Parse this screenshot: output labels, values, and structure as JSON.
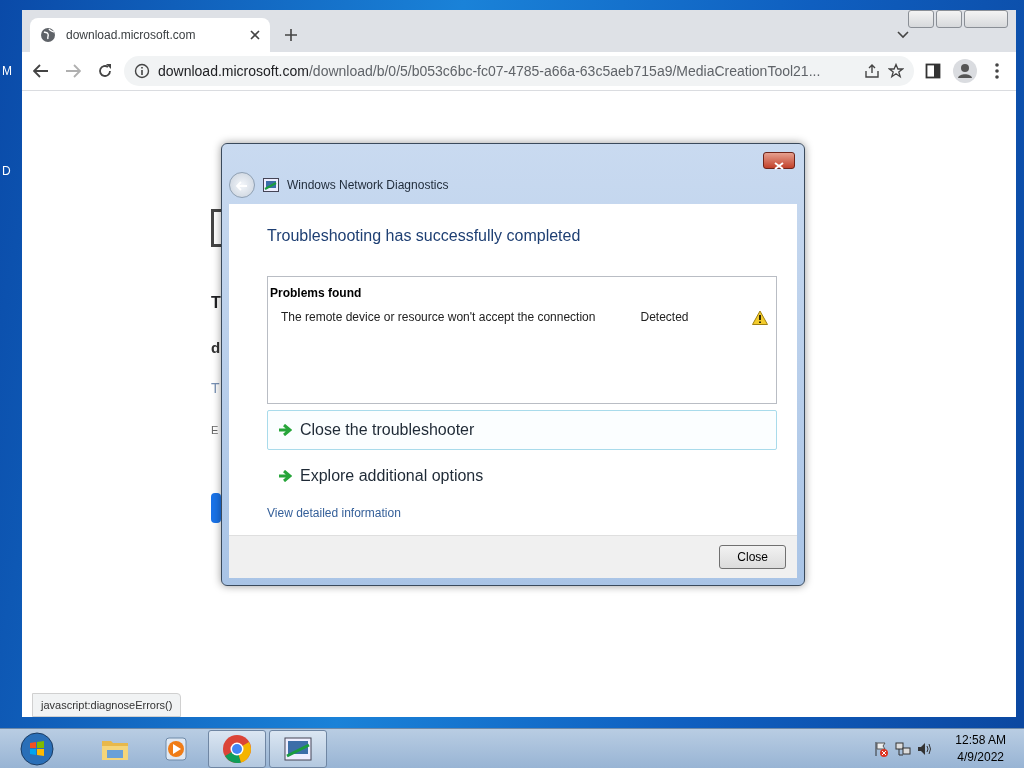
{
  "desktop": {
    "icon_label_fragments": [
      "M",
      "D"
    ]
  },
  "browser": {
    "tab": {
      "title": "download.microsoft.com",
      "selected": true
    },
    "address": {
      "host": "download.microsoft.com",
      "path": "/download/b/0/5/b053c6bc-fc07-4785-a66a-63c5aeb715a9/MediaCreationTool21..."
    },
    "page_fragments": [
      {
        "kind": "heading",
        "text": "T"
      },
      {
        "kind": "subheading",
        "text": "d"
      },
      {
        "kind": "link",
        "text": "T"
      },
      {
        "kind": "note",
        "text": "E"
      }
    ],
    "status_url": "javascript:diagnoseErrors()"
  },
  "dialog": {
    "title": "Windows Network Diagnostics",
    "heading": "Troubleshooting has successfully completed",
    "problems": {
      "header": "Problems found",
      "rows": [
        {
          "description": "The remote device or resource won't accept the connection",
          "status": "Detected"
        }
      ]
    },
    "options": [
      {
        "label": "Close the troubleshooter",
        "selected": true
      },
      {
        "label": "Explore additional options",
        "selected": false
      }
    ],
    "details_link": "View detailed information",
    "buttons": [
      "Close"
    ]
  },
  "taskbar": {
    "apps": [
      {
        "kind": "explorer",
        "active": false
      },
      {
        "kind": "media",
        "active": false
      },
      {
        "kind": "chrome",
        "active": true
      },
      {
        "kind": "diagnostics",
        "active": true
      }
    ],
    "time": "12:58 AM",
    "date": "4/9/2022"
  }
}
